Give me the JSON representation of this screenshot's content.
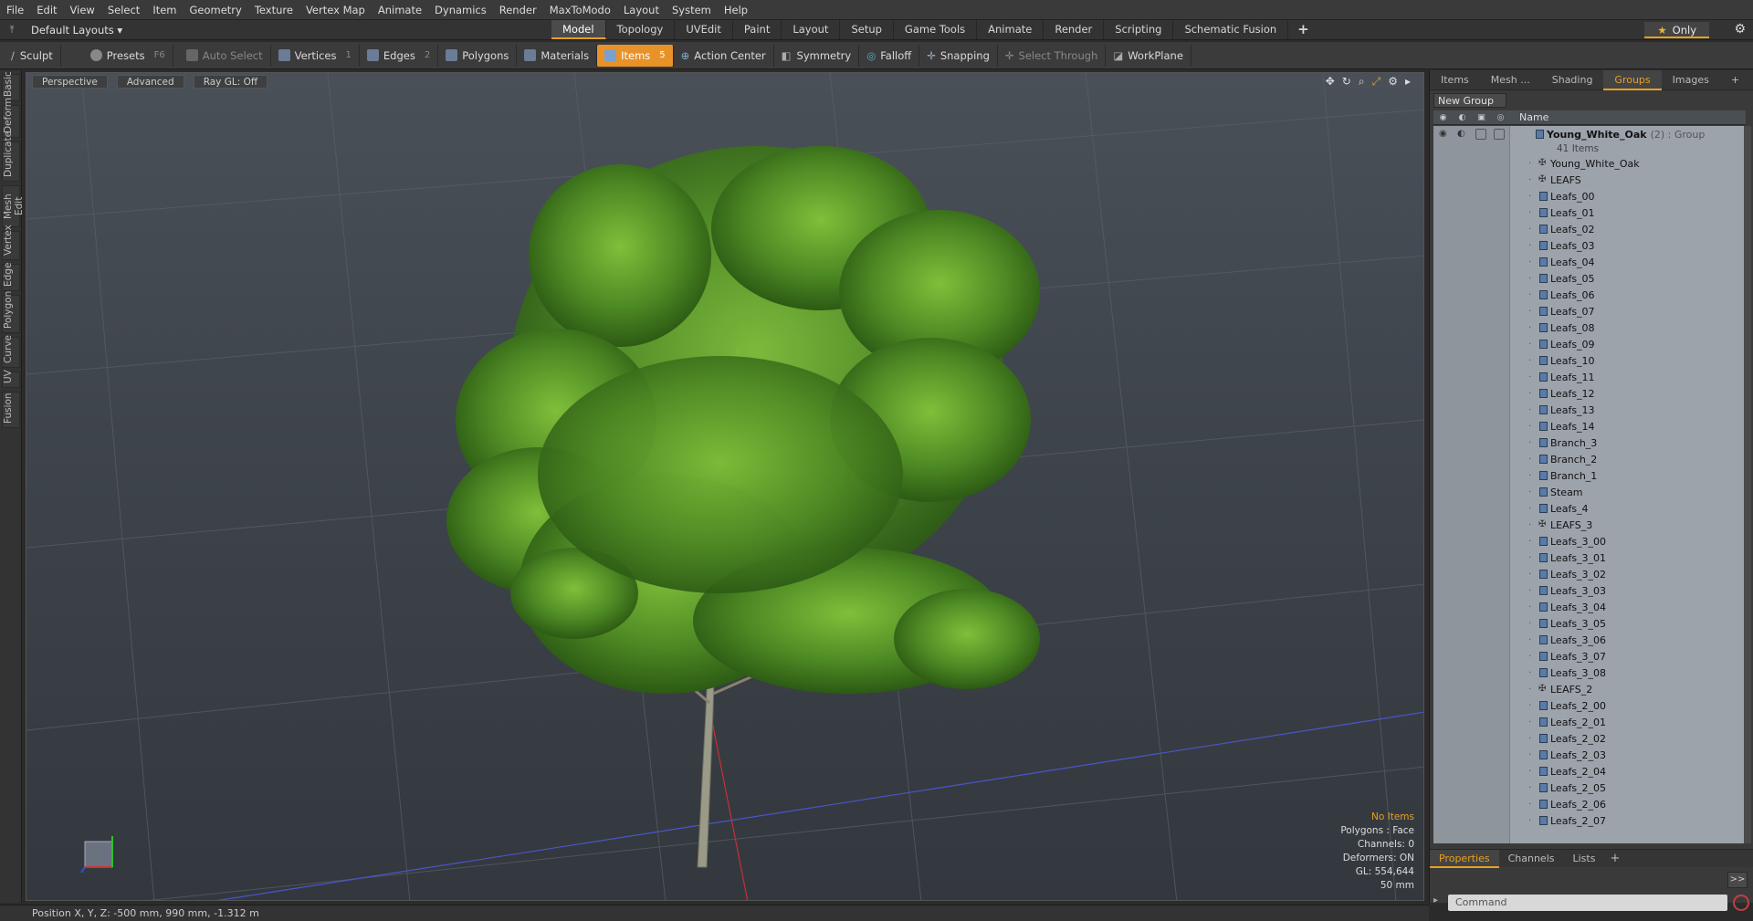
{
  "menubar": {
    "items": [
      "File",
      "Edit",
      "View",
      "Select",
      "Item",
      "Geometry",
      "Texture",
      "Vertex Map",
      "Animate",
      "Dynamics",
      "Render",
      "MaxToModo",
      "Layout",
      "System",
      "Help"
    ]
  },
  "layout_row": {
    "layout_label": "Default Layouts ▾",
    "tabs": [
      "Model",
      "Topology",
      "UVEdit",
      "Paint",
      "Layout",
      "Setup",
      "Game Tools",
      "Animate",
      "Render",
      "Scripting",
      "Schematic Fusion",
      "+"
    ],
    "active_tab": "Model",
    "only_label": "Only"
  },
  "toolbar": {
    "sculpt": "Sculpt",
    "presets": "Presets",
    "presets_key": "F6",
    "auto_select": "Auto Select",
    "vertices": "Vertices",
    "vertices_key": "1",
    "edges": "Edges",
    "edges_key": "2",
    "polygons": "Polygons",
    "materials": "Materials",
    "items": "Items",
    "items_key": "5",
    "action_center": "Action Center",
    "symmetry": "Symmetry",
    "falloff": "Falloff",
    "snapping": "Snapping",
    "select_through": "Select Through",
    "workplane": "WorkPlane"
  },
  "left_tabs": [
    "Basic",
    "Deform",
    "Duplicate",
    "Mesh Edit",
    "Vertex",
    "Edge",
    "Polygon",
    "Curve",
    "UV",
    "Fusion"
  ],
  "viewport": {
    "view_label": "Perspective",
    "mode_label": "Advanced",
    "raygl_label": "Ray GL: Off",
    "info": {
      "no_items": "No Items",
      "polygons": "Polygons : Face",
      "channels": "Channels: 0",
      "deformers": "Deformers: ON",
      "gl": "GL: 554,644",
      "unit": "50 mm"
    }
  },
  "right_panel": {
    "tabs": [
      "Items",
      "Mesh ...",
      "Shading",
      "Groups",
      "Images",
      "+"
    ],
    "active_tab": "Groups",
    "new_group_label": "New Group",
    "column_name": "Name",
    "group": {
      "name": "Young_White_Oak",
      "suffix": "(2) : Group",
      "count": "41 Items"
    },
    "items": [
      {
        "label": "Young_White_Oak",
        "type": "locator"
      },
      {
        "label": "LEAFS",
        "type": "locator"
      },
      {
        "label": "Leafs_00",
        "type": "mesh"
      },
      {
        "label": "Leafs_01",
        "type": "mesh"
      },
      {
        "label": "Leafs_02",
        "type": "mesh"
      },
      {
        "label": "Leafs_03",
        "type": "mesh"
      },
      {
        "label": "Leafs_04",
        "type": "mesh"
      },
      {
        "label": "Leafs_05",
        "type": "mesh"
      },
      {
        "label": "Leafs_06",
        "type": "mesh"
      },
      {
        "label": "Leafs_07",
        "type": "mesh"
      },
      {
        "label": "Leafs_08",
        "type": "mesh"
      },
      {
        "label": "Leafs_09",
        "type": "mesh"
      },
      {
        "label": "Leafs_10",
        "type": "mesh"
      },
      {
        "label": "Leafs_11",
        "type": "mesh"
      },
      {
        "label": "Leafs_12",
        "type": "mesh"
      },
      {
        "label": "Leafs_13",
        "type": "mesh"
      },
      {
        "label": "Leafs_14",
        "type": "mesh"
      },
      {
        "label": "Branch_3",
        "type": "mesh"
      },
      {
        "label": "Branch_2",
        "type": "mesh"
      },
      {
        "label": "Branch_1",
        "type": "mesh"
      },
      {
        "label": "Steam",
        "type": "mesh"
      },
      {
        "label": "Leafs_4",
        "type": "mesh"
      },
      {
        "label": "LEAFS_3",
        "type": "locator"
      },
      {
        "label": "Leafs_3_00",
        "type": "mesh"
      },
      {
        "label": "Leafs_3_01",
        "type": "mesh"
      },
      {
        "label": "Leafs_3_02",
        "type": "mesh"
      },
      {
        "label": "Leafs_3_03",
        "type": "mesh"
      },
      {
        "label": "Leafs_3_04",
        "type": "mesh"
      },
      {
        "label": "Leafs_3_05",
        "type": "mesh"
      },
      {
        "label": "Leafs_3_06",
        "type": "mesh"
      },
      {
        "label": "Leafs_3_07",
        "type": "mesh"
      },
      {
        "label": "Leafs_3_08",
        "type": "mesh"
      },
      {
        "label": "LEAFS_2",
        "type": "locator"
      },
      {
        "label": "Leafs_2_00",
        "type": "mesh"
      },
      {
        "label": "Leafs_2_01",
        "type": "mesh"
      },
      {
        "label": "Leafs_2_02",
        "type": "mesh"
      },
      {
        "label": "Leafs_2_03",
        "type": "mesh"
      },
      {
        "label": "Leafs_2_04",
        "type": "mesh"
      },
      {
        "label": "Leafs_2_05",
        "type": "mesh"
      },
      {
        "label": "Leafs_2_06",
        "type": "mesh"
      },
      {
        "label": "Leafs_2_07",
        "type": "mesh"
      }
    ],
    "bottom_tabs": [
      "Properties",
      "Channels",
      "Lists",
      "+"
    ],
    "active_bottom_tab": "Properties",
    "expand_label": ">>",
    "command_placeholder": "Command"
  },
  "statusbar": {
    "text": "Position X, Y, Z:  -500 mm, 990 mm, -1.312 m"
  },
  "colors": {
    "accent": "#e8a020",
    "tree_green": "#4e8a24",
    "list_bg": "#9ca3ab"
  }
}
